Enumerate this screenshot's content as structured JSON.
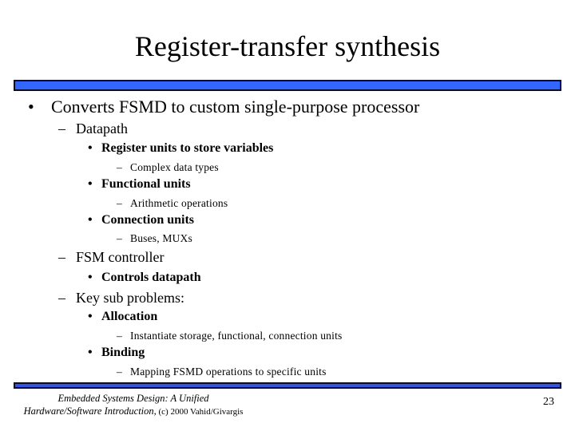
{
  "slide": {
    "title": "Register-transfer synthesis",
    "colors": {
      "bar_fill": "#3366ff",
      "footer_bar_fill": "#3355dd",
      "bar_border": "#0a0a2a"
    }
  },
  "outline": [
    {
      "level": 1,
      "marker": "•",
      "text": "Converts FSMD to custom single-purpose processor"
    },
    {
      "level": 2,
      "marker": "–",
      "text": "Datapath"
    },
    {
      "level": 3,
      "marker": "•",
      "text": "Register units to store variables"
    },
    {
      "level": 4,
      "marker": "–",
      "text": "Complex data types"
    },
    {
      "level": 3,
      "marker": "•",
      "text": "Functional units"
    },
    {
      "level": 4,
      "marker": "–",
      "text": "Arithmetic operations"
    },
    {
      "level": 3,
      "marker": "•",
      "text": "Connection units"
    },
    {
      "level": 4,
      "marker": "–",
      "text": "Buses,  MUXs"
    },
    {
      "level": 2,
      "marker": "–",
      "text": "FSM controller"
    },
    {
      "level": 3,
      "marker": "•",
      "text": "Controls datapath"
    },
    {
      "level": 2,
      "marker": "–",
      "text": "Key sub problems:"
    },
    {
      "level": 3,
      "marker": "•",
      "text": "Allocation"
    },
    {
      "level": 4,
      "marker": "–",
      "text": "Instantiate storage, functional, connection units"
    },
    {
      "level": 3,
      "marker": "•",
      "text": "Binding"
    },
    {
      "level": 4,
      "marker": "–",
      "text": "Mapping FSMD operations to specific units"
    }
  ],
  "footer": {
    "credit_line1": "Embedded Systems Design: A Unified",
    "credit_line2_italic": "Hardware/Software Introduction,",
    "credit_line2_plain": " (c) 2000 Vahid/Givargis",
    "page_number": "23"
  }
}
